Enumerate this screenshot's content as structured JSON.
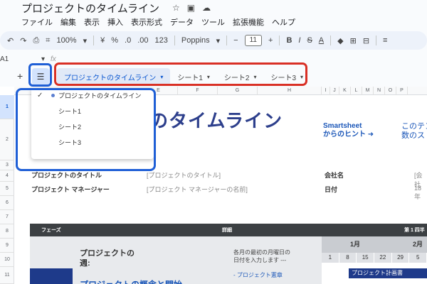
{
  "title": "プロジェクトのタイムライン",
  "menu": [
    "ファイル",
    "編集",
    "表示",
    "挿入",
    "表示形式",
    "データ",
    "ツール",
    "拡張機能",
    "ヘルプ"
  ],
  "toolbar": {
    "zoom": "100%",
    "currency": "¥",
    "percent": "%",
    "dec_minus": ".0",
    "dec_plus": ".00",
    "format": "123",
    "font": "Poppins",
    "font_size": "11",
    "minus": "−",
    "plus": "+"
  },
  "formula": {
    "cell": "A1",
    "fx": "fx"
  },
  "tabs": {
    "add": "+",
    "all_sheets_icon": "hamburger-icon",
    "items": [
      {
        "label": "プロジェクトのタイムライン",
        "active": true
      },
      {
        "label": "シート1",
        "active": false
      },
      {
        "label": "シート2",
        "active": false
      },
      {
        "label": "シート3",
        "active": false
      }
    ]
  },
  "dropdown": {
    "items": [
      {
        "label": "プロジェクトのタイムライン",
        "checked": true
      },
      {
        "label": "シート1",
        "checked": false
      },
      {
        "label": "シート2",
        "checked": false
      },
      {
        "label": "シート3",
        "checked": false
      }
    ]
  },
  "grid": {
    "columns": [
      "E",
      "F",
      "G",
      "H",
      "I",
      "J",
      "K",
      "L",
      "M",
      "N",
      "O",
      "P"
    ],
    "rows": [
      "1",
      "2",
      "3",
      "4",
      "5",
      "6",
      "7",
      "8",
      "9",
      "10",
      "11"
    ],
    "big_title": "のタイムライン",
    "hint_line1": "Smartsheet",
    "hint_line2": "からのヒント ➜",
    "hint_right1": "このテン",
    "hint_right2": "数のス",
    "proj_title_label": "プロジェクトのタイトル",
    "proj_title_value": "[プロジェクトのタイトル]",
    "pm_label": "プロジェクト マネージャー",
    "pm_value": "[プロジェクト マネージャーの名前]",
    "company_label": "会社名",
    "company_value": "[会社",
    "date_label": "日付",
    "date_value": "18年",
    "phase_header": "フェーズ",
    "detail_header": "詳細",
    "quarter_header": "第 1 四半",
    "proj_week_1": "プロジェクトの",
    "proj_week_2": "週:",
    "note_1": "各月の最初の月曜日の",
    "note_2": "日付を入力します ---",
    "sub_item": "- プロジェクト憲章",
    "month_1": "1月",
    "month_2": "2月",
    "weeks": [
      "1",
      "8",
      "15",
      "22",
      "29",
      "5"
    ],
    "plan_bar": "プロジェクト計画書",
    "cut_text": "プロジェクトの概念と開始"
  }
}
